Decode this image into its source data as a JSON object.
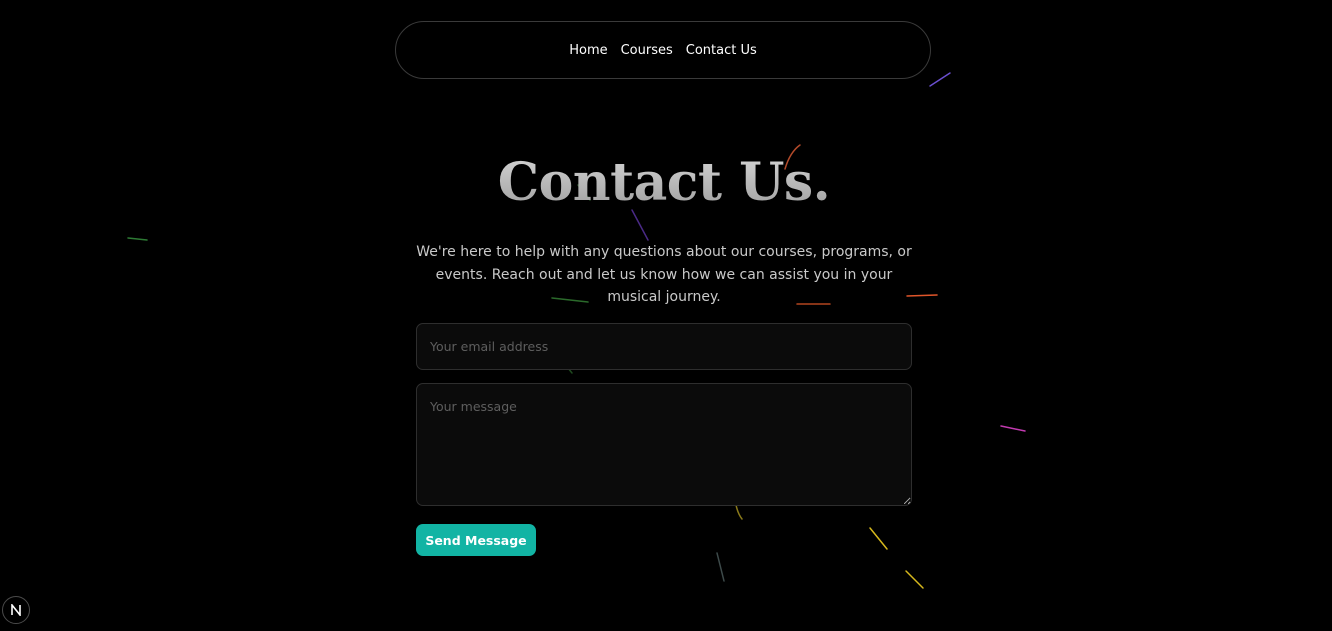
{
  "nav": {
    "links": [
      {
        "label": "Home"
      },
      {
        "label": "Courses"
      },
      {
        "label": "Contact Us"
      }
    ]
  },
  "main": {
    "title": "Contact Us.",
    "description": "We're here to help with any questions about our courses, programs, or events. Reach out and let us know how we can assist you in your musical journey.",
    "form": {
      "email_placeholder": "Your email address",
      "email_value": "",
      "message_placeholder": "Your message",
      "message_value": "",
      "submit_label": "Send Message"
    }
  },
  "theme": {
    "background": "#000000",
    "accent": "#12b4a4",
    "text": "#d4d4d4"
  },
  "devtools": {
    "badge_icon": "nextjs-logo-icon"
  }
}
